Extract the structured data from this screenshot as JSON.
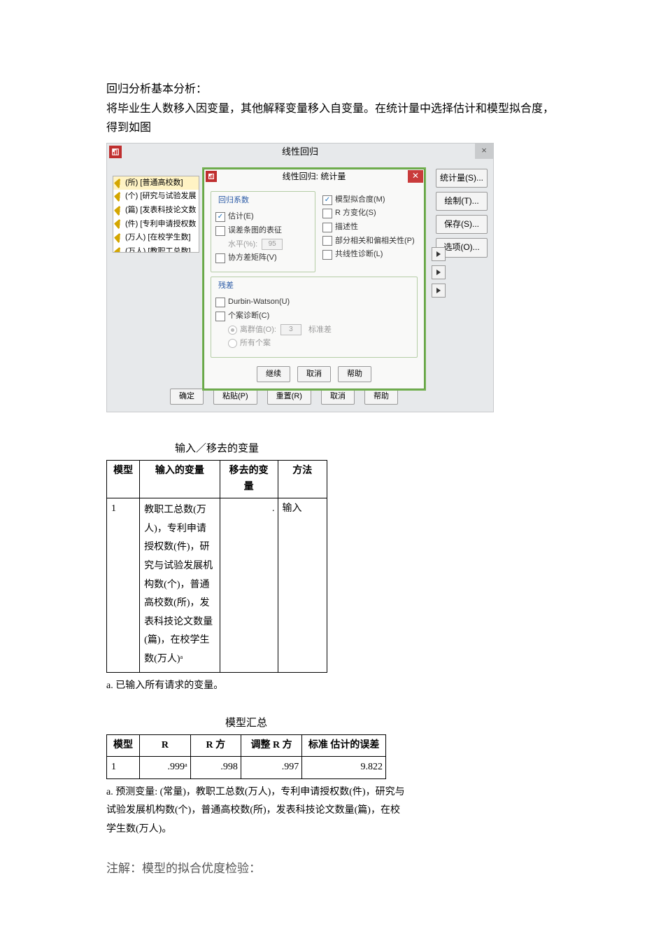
{
  "intro": {
    "l1": "回归分析基本分析：",
    "l2": "将毕业生人数移入因变量，其他解释变量移入自变量。在统计量中选择估计和模型拟合度，",
    "l3": "得到如图"
  },
  "dialog": {
    "title": "线性回归",
    "close_label": "×",
    "vars": [
      "(所) [普通高校数]",
      "(个) [研究与试验发展",
      "(篇) [发表科技论文数",
      "(件) [专利申请授权数",
      "(万人) [在校学生数]",
      "(万人) [教职工总数]"
    ],
    "side_buttons": {
      "stats": "统计量(S)...",
      "plot": "绘制(T)...",
      "save": "保存(S)...",
      "options": "选项(O)..."
    },
    "sub": {
      "title": "线性回归: 统计量",
      "group_regcoef": "回归系数",
      "estimate": "估计(E)",
      "conf_int": "误差条图的表征",
      "level_label": "水平(%):",
      "level_value": "95",
      "cov_matrix": "协方差矩阵(V)",
      "model_fit": "模型拟合度(M)",
      "r2_change": "R 方变化(S)",
      "descriptives": "描述性",
      "partial": "部分相关和偏相关性(P)",
      "collinearity": "共线性诊断(L)",
      "group_residual": "残差",
      "durbin": "Durbin-Watson(U)",
      "casewise": "个案诊断(C)",
      "outlier_label": "离群值(O):",
      "outlier_value": "3",
      "outlier_unit": "标准差",
      "all_cases": "所有个案",
      "btn_continue": "继续",
      "btn_cancel": "取消",
      "btn_help": "帮助"
    },
    "bottom": {
      "ok": "确定",
      "paste": "粘贴(P)",
      "reset": "重置(R)",
      "cancel": "取消",
      "help": "帮助"
    }
  },
  "table1": {
    "title": "输入／移去的变量",
    "h1": "模型",
    "h2": "输入的变量",
    "h3": "移去的变量",
    "h4": "方法",
    "r1c1": "1",
    "r1c2": "教职工总数(万人)，专利申请授权数(件)，研究与试验发展机构数(个)，普通高校数(所)，发表科技论文数量(篇)，在校学生数(万人)ᵃ",
    "r1c3": ".",
    "r1c4": "输入",
    "note": "a. 已输入所有请求的变量。"
  },
  "table2": {
    "title": "模型汇总",
    "h1": "模型",
    "h2": "R",
    "h3": "R 方",
    "h4": "调整 R 方",
    "h5": "标准 估计的误差",
    "r1c1": "1",
    "r1c2": ".999ᵃ",
    "r1c3": ".998",
    "r1c4": ".997",
    "r1c5": "9.822",
    "note": "a. 预测变量: (常量)，教职工总数(万人)，专利申请授权数(件)，研究与试验发展机构数(个)，普通高校数(所)，发表科技论文数量(篇)，在校学生数(万人)。"
  },
  "closing": "注解：模型的拟合优度检验："
}
